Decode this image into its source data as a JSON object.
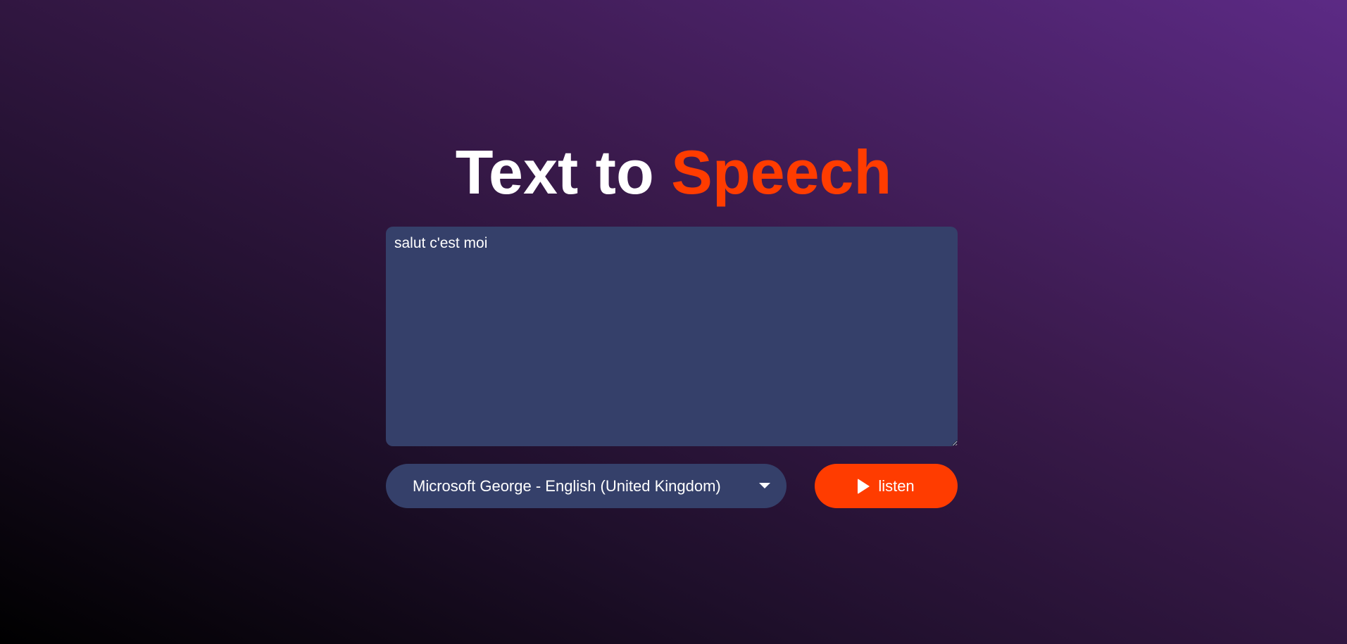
{
  "header": {
    "title_plain": "Text to ",
    "title_accent": "Speech"
  },
  "editor": {
    "value": "salut c'est moi"
  },
  "voice_select": {
    "selected": "Microsoft George - English (United Kingdom)",
    "icon": "chevron-down-icon"
  },
  "listen_button": {
    "label": "listen",
    "icon": "play-icon"
  },
  "colors": {
    "accent": "#ff3c00",
    "panel": "#35406a",
    "background_dark": "#000000",
    "background_light": "#5c2a85"
  }
}
